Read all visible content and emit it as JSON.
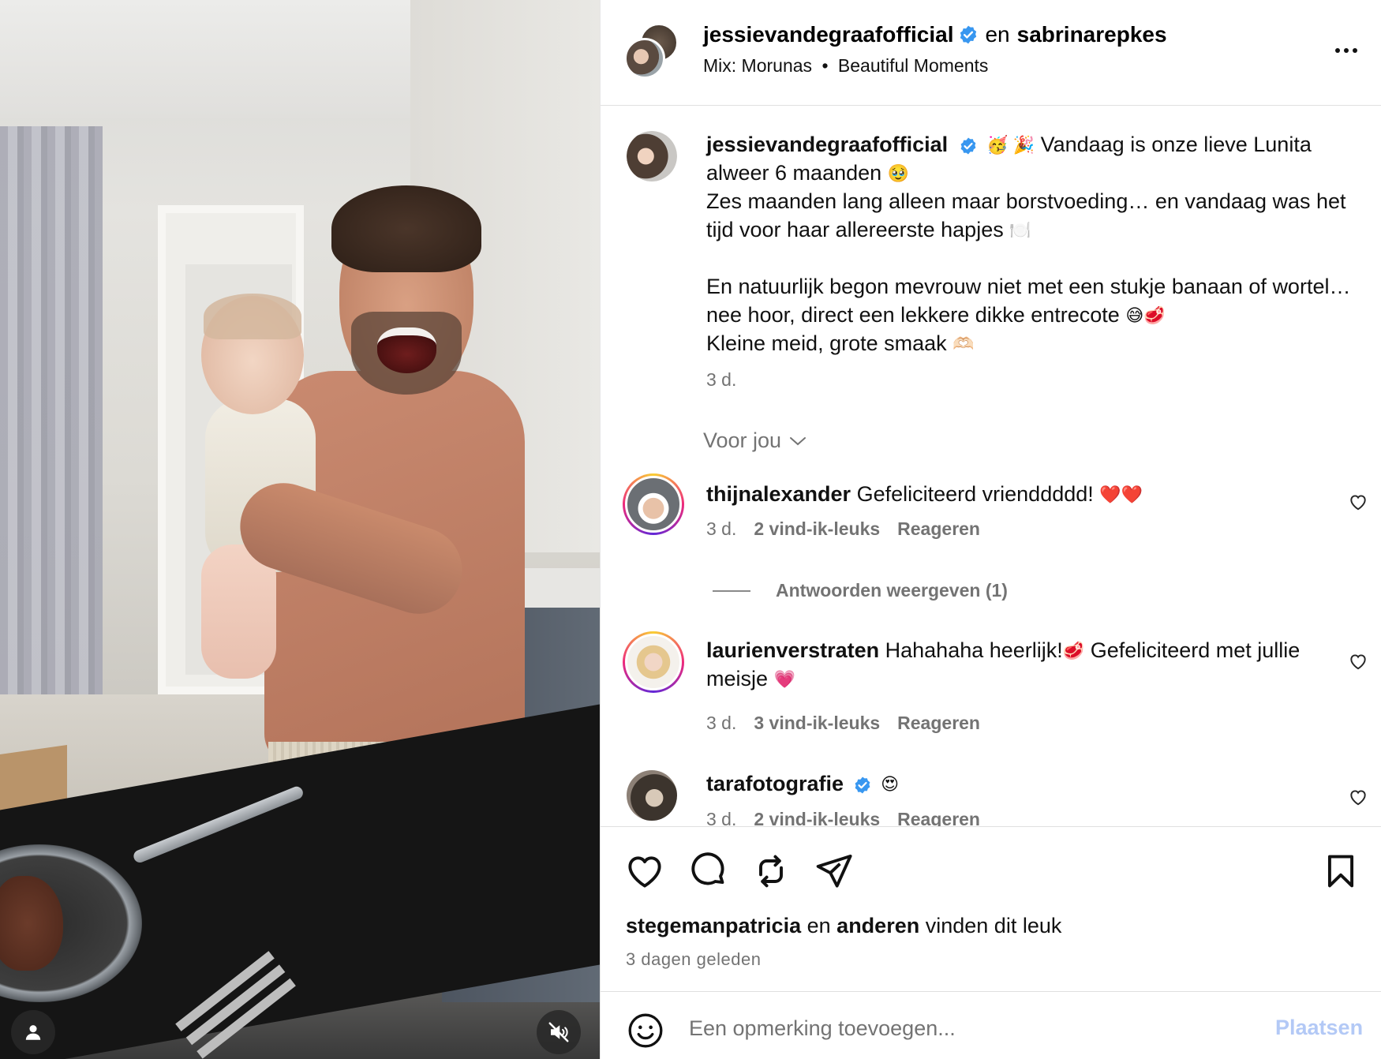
{
  "post": {
    "author": "jessievandegraafofficial",
    "conjunction": "en",
    "coauthor": "sabrinarepkes",
    "audio": "Mix: Morunas",
    "audio_sep": "•",
    "audio_track": "Beautiful Moments"
  },
  "caption": {
    "username": "jessievandegraafofficial",
    "emojis_lead": "🥳 🎉",
    "line1": "Vandaag is onze lieve Lunita alweer 6 maanden",
    "emoji_after_line1": "🥹",
    "line2": "Zes maanden lang alleen maar borstvoeding… en vandaag was het tijd voor haar allereerste hapjes",
    "emoji_after_line2": "🍽️",
    "line3": "En natuurlijk begon mevrouw niet met een stukje banaan of wortel… nee hoor, direct een lekkere dikke entrecote",
    "emoji_after_line3": "😅🥩",
    "line4": "Kleine meid, grote smaak",
    "emoji_after_line4": "🫶🏻",
    "time": "3 d."
  },
  "sort": {
    "label": "Voor jou"
  },
  "comments": [
    {
      "username": "thijnalexander",
      "text": "Gefeliciteerd vrienddddd!",
      "emoji": "❤️❤️",
      "time": "3 d.",
      "likes": "2 vind-ik-leuks",
      "reply": "Reageren",
      "view_replies": "Antwoorden weergeven (1)"
    },
    {
      "username": "laurienverstraten",
      "text_a": "Hahahaha heerlijk!",
      "emoji_a": "🥩",
      "text_b": "Gefeliciteerd met jullie meisje",
      "emoji_b": "💗",
      "time": "3 d.",
      "likes": "3 vind-ik-leuks",
      "reply": "Reageren"
    },
    {
      "username": "tarafotografie",
      "emoji": "😍",
      "time": "3 d.",
      "likes": "2 vind-ik-leuks",
      "reply": "Reageren"
    }
  ],
  "likes": {
    "user": "stegemanpatricia",
    "conj": "en",
    "others": "anderen",
    "suffix": "vinden dit leuk"
  },
  "date": "3 dagen geleden",
  "comment_box": {
    "placeholder": "Een opmerking toevoegen...",
    "post_label": "Plaatsen"
  },
  "colors": {
    "verified": "#3897f0",
    "secondary_text": "#737373",
    "post_button_disabled": "#b3c9f6"
  },
  "icons": {
    "like": "heart-icon",
    "comment": "speech-bubble-icon",
    "repost": "repost-icon",
    "share": "paper-plane-icon",
    "save": "bookmark-icon",
    "more": "ellipsis-icon",
    "mute": "speaker-muted-icon",
    "tags": "user-tag-icon",
    "emoji": "smiley-icon"
  }
}
